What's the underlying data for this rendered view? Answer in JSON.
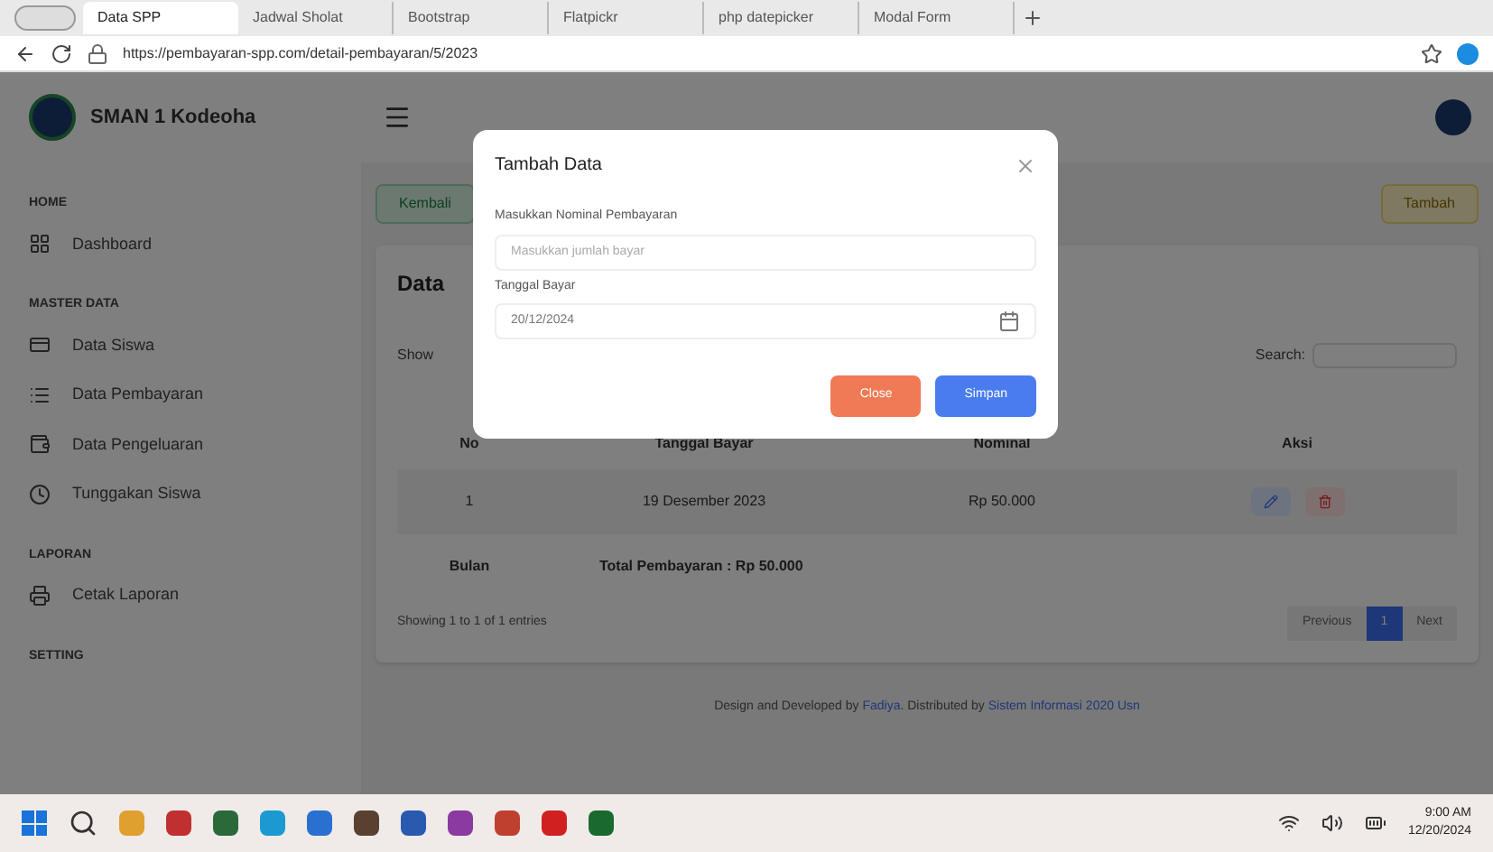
{
  "browser": {
    "tabs": [
      {
        "title": "Data SPP",
        "selected": true
      },
      {
        "title": "Jadwal Sholat",
        "selected": false
      },
      {
        "title": "Bootstrap",
        "selected": false
      },
      {
        "title": "Flatpickr",
        "selected": false
      },
      {
        "title": "php datepicker",
        "selected": false
      },
      {
        "title": "Modal Form",
        "selected": false
      }
    ],
    "url": "https://pembayaran-spp.com/detail-pembayaran/5/2023"
  },
  "app": {
    "brand": "SMAN 1 Kodeoha",
    "sidebar": [
      {
        "kind": "heading",
        "label": "HOME"
      },
      {
        "kind": "item",
        "label": "Dashboard"
      },
      {
        "kind": "heading",
        "label": "MASTER DATA"
      },
      {
        "kind": "item",
        "label": "Data Siswa"
      },
      {
        "kind": "item",
        "label": "Data Pembayaran"
      },
      {
        "kind": "item",
        "label": "Data Pengeluaran"
      },
      {
        "kind": "item",
        "label": "Tunggakan Siswa"
      },
      {
        "kind": "heading",
        "label": "LAPORAN"
      },
      {
        "kind": "item",
        "label": "Cetak Laporan"
      },
      {
        "kind": "heading",
        "label": "SETTING"
      }
    ],
    "back_button": "Kembali",
    "add_button": "Tambah",
    "card_title": "Data",
    "show_label": "Show",
    "search_label": "Search:",
    "table": {
      "columns": [
        "No",
        "Tanggal Bayar",
        "Nominal",
        "Aksi"
      ],
      "rows": [
        {
          "cells": [
            "1",
            "19 Desember 2023",
            "Rp 50.000"
          ]
        }
      ],
      "footer": {
        "label": "Bulan",
        "total": "Total Pembayaran : Rp 50.000"
      }
    },
    "info": "Showing 1 to 1 of 1 entries",
    "pagination": [
      {
        "label": "Previous",
        "selected": false
      },
      {
        "label": "1",
        "selected": true
      },
      {
        "label": "Next",
        "selected": false
      }
    ],
    "footer": {
      "text_1": "Design and Developed by ",
      "link_1": "Fadiya",
      "text_2": ". Distributed by ",
      "link_2": "Sistem Informasi 2020 Usn"
    }
  },
  "modal": {
    "title": "Tambah Data",
    "fields": [
      {
        "label": "Masukkan Nominal Pembayaran",
        "placeholder": "Masukkan jumlah bayar"
      },
      {
        "label": "Tanggal Bayar",
        "value": "20/12/2024"
      }
    ],
    "buttons": [
      {
        "label": "Close",
        "kind": "secondary"
      },
      {
        "label": "Simpan",
        "kind": "primary"
      }
    ]
  },
  "taskbar": {
    "time": "9:00 AM",
    "date": "12/20/2024"
  }
}
